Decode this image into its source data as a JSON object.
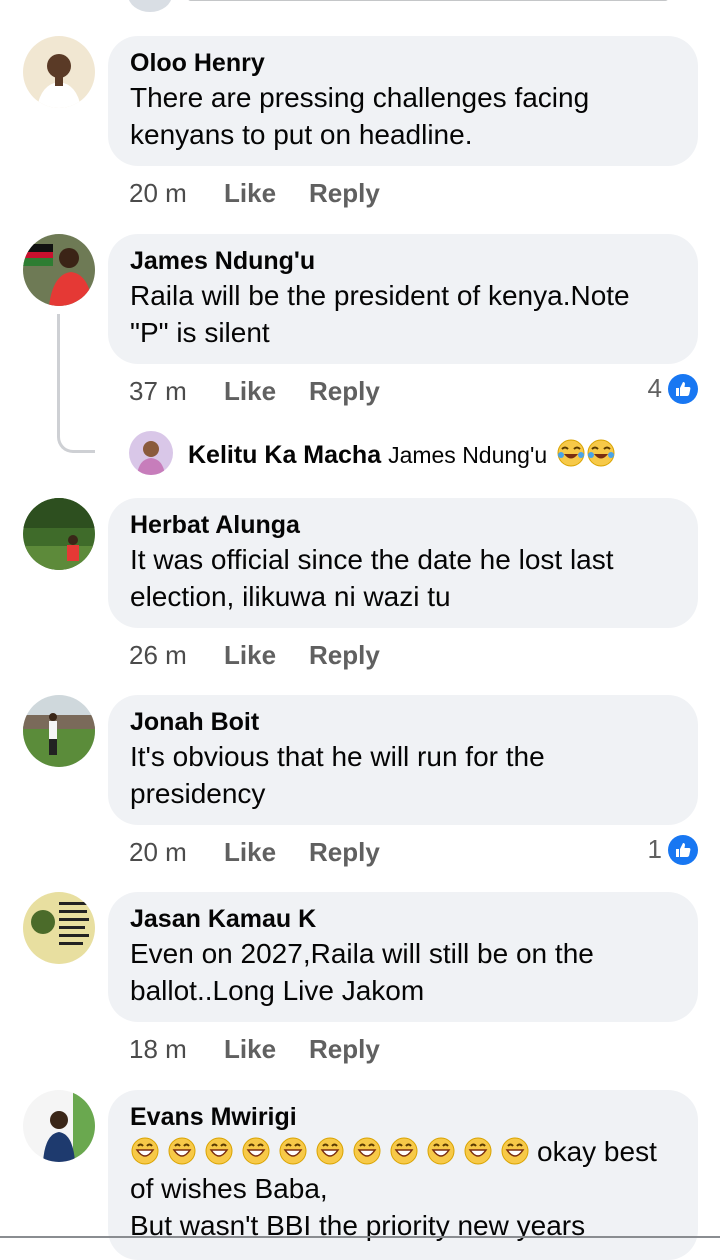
{
  "comments": [
    {
      "name": "Oloo Henry",
      "lines": [
        "There are pressing challenges facing",
        "kenyans to put on headline."
      ],
      "time": "20 m",
      "like": "Like",
      "reply": "Reply"
    },
    {
      "name": "James Ndung'u",
      "lines": [
        "Raila will be the president of kenya.Note",
        "\"P\" is silent"
      ],
      "time": "37 m",
      "like": "Like",
      "reply": "Reply",
      "reactions": "4"
    },
    {
      "name": "Herbat Alunga",
      "lines": [
        "It was official since the date he lost last",
        "election, ilikuwa ni wazi tu"
      ],
      "time": "26 m",
      "like": "Like",
      "reply": "Reply"
    },
    {
      "name": "Jonah Boit",
      "lines": [
        "It's obvious that he will run for the",
        "presidency"
      ],
      "time": "20 m",
      "like": "Like",
      "reply": "Reply",
      "reactions": "1"
    },
    {
      "name": "Jasan Kamau K",
      "lines": [
        "Even on 2027,Raila will still be on the",
        "ballot..Long Live Jakom"
      ],
      "time": "18 m",
      "like": "Like",
      "reply": "Reply"
    },
    {
      "name": "Evans Mwirigi",
      "lines": [
        "okay best",
        "of wishes Baba,",
        "But wasn't BBI the priority new years"
      ]
    }
  ],
  "reply_preview": {
    "name": "Kelitu Ka Macha",
    "text": "James Ndung'u"
  },
  "colors": {
    "bubble": "#f0f2f5",
    "like_blue": "#1877f2",
    "meta_gray": "#606060"
  },
  "icons": {
    "reaction": "like-thumb-icon",
    "emoji": "grinning-emoji-icon",
    "laugh": "tears-of-joy-emoji-icon"
  }
}
